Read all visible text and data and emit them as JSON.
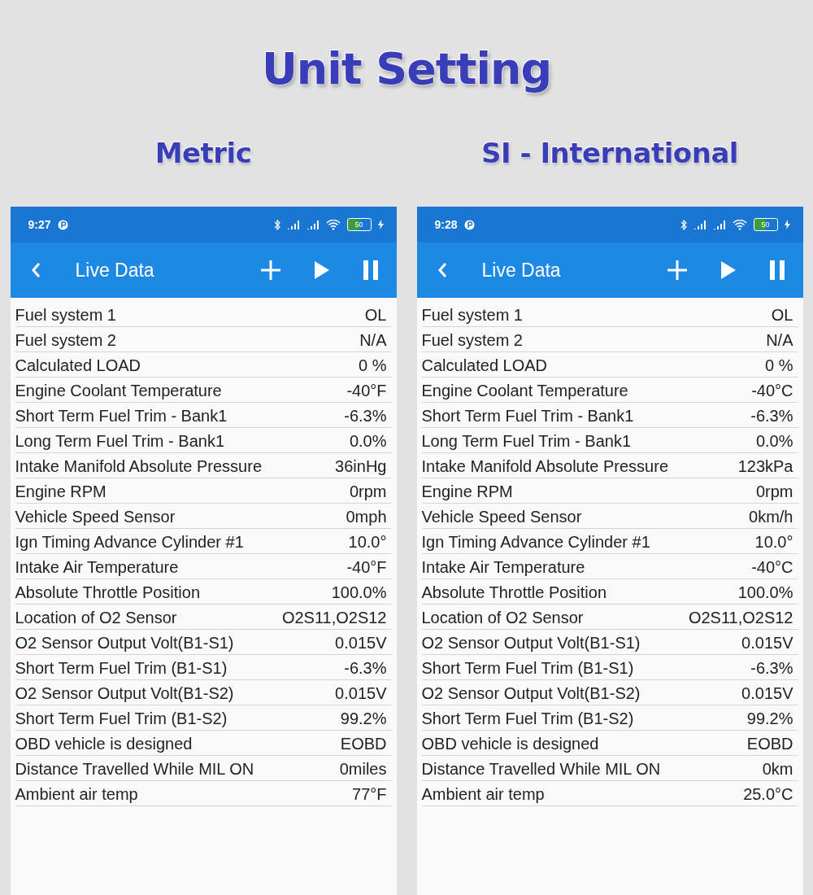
{
  "title": "Unit Setting",
  "panels": [
    {
      "heading": "Metric",
      "status_bar": {
        "time": "9:27",
        "battery": "50"
      },
      "toolbar": {
        "title": "Live Data"
      },
      "rows": [
        {
          "label": "Fuel system 1",
          "value": "OL"
        },
        {
          "label": "Fuel system 2",
          "value": "N/A"
        },
        {
          "label": "Calculated LOAD",
          "value": "0 %"
        },
        {
          "label": "Engine Coolant Temperature",
          "value": "-40°F"
        },
        {
          "label": "Short Term Fuel Trim - Bank1",
          "value": "-6.3%"
        },
        {
          "label": "Long Term Fuel Trim - Bank1",
          "value": "0.0%"
        },
        {
          "label": "Intake Manifold Absolute Pressure",
          "value": "36inHg"
        },
        {
          "label": "Engine RPM",
          "value": "0rpm"
        },
        {
          "label": "Vehicle Speed Sensor",
          "value": "0mph"
        },
        {
          "label": "Ign Timing Advance Cylinder #1",
          "value": "10.0°"
        },
        {
          "label": "Intake Air Temperature",
          "value": "-40°F"
        },
        {
          "label": "Absolute Throttle Position",
          "value": "100.0%"
        },
        {
          "label": "Location of O2 Sensor",
          "value": "O2S11,O2S12"
        },
        {
          "label": "O2 Sensor Output Volt(B1-S1)",
          "value": "0.015V"
        },
        {
          "label": "Short Term Fuel Trim (B1-S1)",
          "value": "-6.3%"
        },
        {
          "label": "O2 Sensor Output Volt(B1-S2)",
          "value": "0.015V"
        },
        {
          "label": "Short Term Fuel Trim (B1-S2)",
          "value": "99.2%"
        },
        {
          "label": "OBD vehicle is designed",
          "value": "EOBD"
        },
        {
          "label": "Distance Travelled While MIL ON",
          "value": "0miles"
        },
        {
          "label": "Ambient air temp",
          "value": "77°F"
        }
      ]
    },
    {
      "heading": "SI - International",
      "status_bar": {
        "time": "9:28",
        "battery": "50"
      },
      "toolbar": {
        "title": "Live Data"
      },
      "rows": [
        {
          "label": "Fuel system 1",
          "value": "OL"
        },
        {
          "label": "Fuel system 2",
          "value": "N/A"
        },
        {
          "label": "Calculated LOAD",
          "value": "0 %"
        },
        {
          "label": "Engine Coolant Temperature",
          "value": "-40°C"
        },
        {
          "label": "Short Term Fuel Trim - Bank1",
          "value": "-6.3%"
        },
        {
          "label": "Long Term Fuel Trim - Bank1",
          "value": "0.0%"
        },
        {
          "label": "Intake Manifold Absolute Pressure",
          "value": "123kPa"
        },
        {
          "label": "Engine RPM",
          "value": "0rpm"
        },
        {
          "label": "Vehicle Speed Sensor",
          "value": "0km/h"
        },
        {
          "label": "Ign Timing Advance Cylinder #1",
          "value": "10.0°"
        },
        {
          "label": "Intake Air Temperature",
          "value": "-40°C"
        },
        {
          "label": "Absolute Throttle Position",
          "value": "100.0%"
        },
        {
          "label": "Location of O2 Sensor",
          "value": "O2S11,O2S12"
        },
        {
          "label": "O2 Sensor Output Volt(B1-S1)",
          "value": "0.015V"
        },
        {
          "label": "Short Term Fuel Trim (B1-S1)",
          "value": "-6.3%"
        },
        {
          "label": "O2 Sensor Output Volt(B1-S2)",
          "value": "0.015V"
        },
        {
          "label": "Short Term Fuel Trim (B1-S2)",
          "value": "99.2%"
        },
        {
          "label": "OBD vehicle is designed",
          "value": "EOBD"
        },
        {
          "label": "Distance Travelled While MIL ON",
          "value": "0km"
        },
        {
          "label": "Ambient air temp",
          "value": "25.0°C"
        }
      ]
    }
  ]
}
